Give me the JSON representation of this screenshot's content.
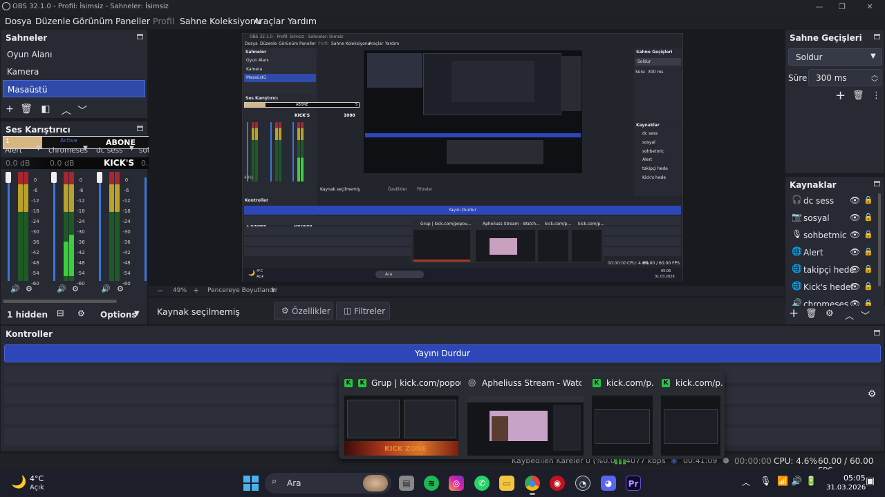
{
  "window": {
    "title": "OBS 32.1.0 - Profil: İsimsiz - Sahneler: İsimsiz",
    "minimize": "—",
    "maximize": "❐",
    "close": "✕"
  },
  "menu": [
    "Dosya",
    "Düzenle",
    "Görünüm",
    "Paneller",
    "Profil",
    "Sahne Koleksiyonu",
    "Araçlar",
    "Yardım"
  ],
  "scenes": {
    "title": "Sahneler",
    "items": [
      "Oyun Alanı",
      "Kamera",
      "Masaüstü"
    ],
    "selected": "Masaüstü"
  },
  "mixer": {
    "title": "Ses Karıştırıcı",
    "overlay": {
      "goal_left": "1",
      "active_label": "Active",
      "goal_name": "ABONE",
      "goal_right": "5",
      "kick_label": "KICK'S",
      "kick_value": "1000",
      "progress_fraction": 0.17
    },
    "channels": [
      {
        "name": "Alert",
        "db": "0.0 dB"
      },
      {
        "name": "chromeses",
        "db": "0.0 dB"
      },
      {
        "name": "dc sess",
        "db": "0.0 dB"
      },
      {
        "name": "sol",
        "db": "0."
      }
    ],
    "scale": [
      "0",
      "-6",
      "-12",
      "-18",
      "-24",
      "-30",
      "-36",
      "-42",
      "-48",
      "-54",
      "-60"
    ],
    "hidden_label": "1 hidden",
    "options_label": "Options"
  },
  "preview": {
    "zoom": "49%",
    "zoom_minus": "−",
    "zoom_plus": "+",
    "fit_label": "Pencereye Boyutlandır"
  },
  "source_bar": {
    "status": "Kaynak seçilmemiş",
    "properties": "Özellikler",
    "filters": "Filtreler"
  },
  "transitions": {
    "title": "Sahne Geçişleri",
    "selected": "Soldur",
    "duration_label": "Süre",
    "duration_value": "300 ms"
  },
  "sources": {
    "title": "Kaynaklar",
    "items": [
      {
        "name": "dc sess",
        "icon": "🎧"
      },
      {
        "name": "sosyal",
        "icon": "📷"
      },
      {
        "name": "sohbetmic",
        "icon": "🎙"
      },
      {
        "name": "Alert",
        "icon": "🌐"
      },
      {
        "name": "takipçi hedef",
        "icon": "🌐"
      },
      {
        "name": "Kick's hedef",
        "icon": "🌐"
      },
      {
        "name": "chromeses",
        "icon": "🔊"
      }
    ]
  },
  "controls": {
    "title": "Kontroller",
    "stream_button": "Yayını Durdur"
  },
  "statusbar": {
    "dropped": "Kaybedilen Kareler 0 (%0.0)",
    "bitrate": "4077 kbps",
    "stream_time": "00:41:09",
    "rec_time": "00:00:00",
    "cpu": "CPU: 4.6%",
    "fps": "60.00 / 60.00 FPS"
  },
  "taskbar_popup": {
    "windows": [
      {
        "title": "Grup | kick.com/popou..."
      },
      {
        "title": "Apheliuss Stream - Watch..."
      },
      {
        "title": "kick.com/p..."
      },
      {
        "title": "kick.com/p..."
      }
    ],
    "thumb_caption": "KICK ZONE"
  },
  "nested": {
    "title": "OBS 32.1.0 - Profil: İsimsiz - Sahneler: İsimsiz",
    "menu": [
      "Dosya",
      "Düzenle",
      "Görünüm",
      "Paneller",
      "Profil",
      "Sahne Koleksiyonu",
      "Araçlar",
      "Yardım"
    ],
    "scenes_title": "Sahneler",
    "scenes": [
      "Oyun Alanı",
      "Kamera",
      "Masaüstü"
    ],
    "mixer_title": "Ses Karıştırıcı",
    "goal": "ABONE",
    "goal_right": "5",
    "kick_label": "KICK'S",
    "kick_value": "1000",
    "hidden": "1 hidden",
    "options": "Options",
    "source_status": "Kaynak seçilmemiş",
    "properties": "Özellikler",
    "filters": "Filtreler",
    "trans_title": "Sahne Geçişleri",
    "trans_selected": "Soldur",
    "trans_dur_label": "Süre",
    "trans_dur": "300 ms",
    "sources_title": "Kaynaklar",
    "sources": [
      "dc sess",
      "sosyal",
      "sohbetmic",
      "Alert",
      "takipçi hede",
      "Kick's hede"
    ],
    "controls_title": "Kontroller",
    "stream_button": "Yayını Durdur",
    "zoom": "49%",
    "fit": "Pencereye Boyutlandır",
    "popup": [
      "Grup | kick.com/popou...",
      "Apheliuss Stream - Watch...",
      "kick.com/p...",
      "kick.com/p..."
    ],
    "status_time": "00:00:00",
    "status_cpu": "CPU: 4.6%",
    "status_fps": "60.00 / 60.00 FPS",
    "weather_temp": "4°C",
    "weather_state": "Açık",
    "search": "Ara",
    "clock_time": "05:05",
    "clock_date": "31.03.2026"
  },
  "taskbar": {
    "weather_temp": "4°C",
    "weather_state": "Açık",
    "search_placeholder": "Ara",
    "time": "05:05",
    "date": "31.03.2026"
  },
  "colors": {
    "accent": "#2f4aa8",
    "stream_button": "#2d46b8",
    "meter_green": "#39d13a",
    "meter_yellow": "#b9a22a",
    "meter_red": "#a8262e"
  }
}
